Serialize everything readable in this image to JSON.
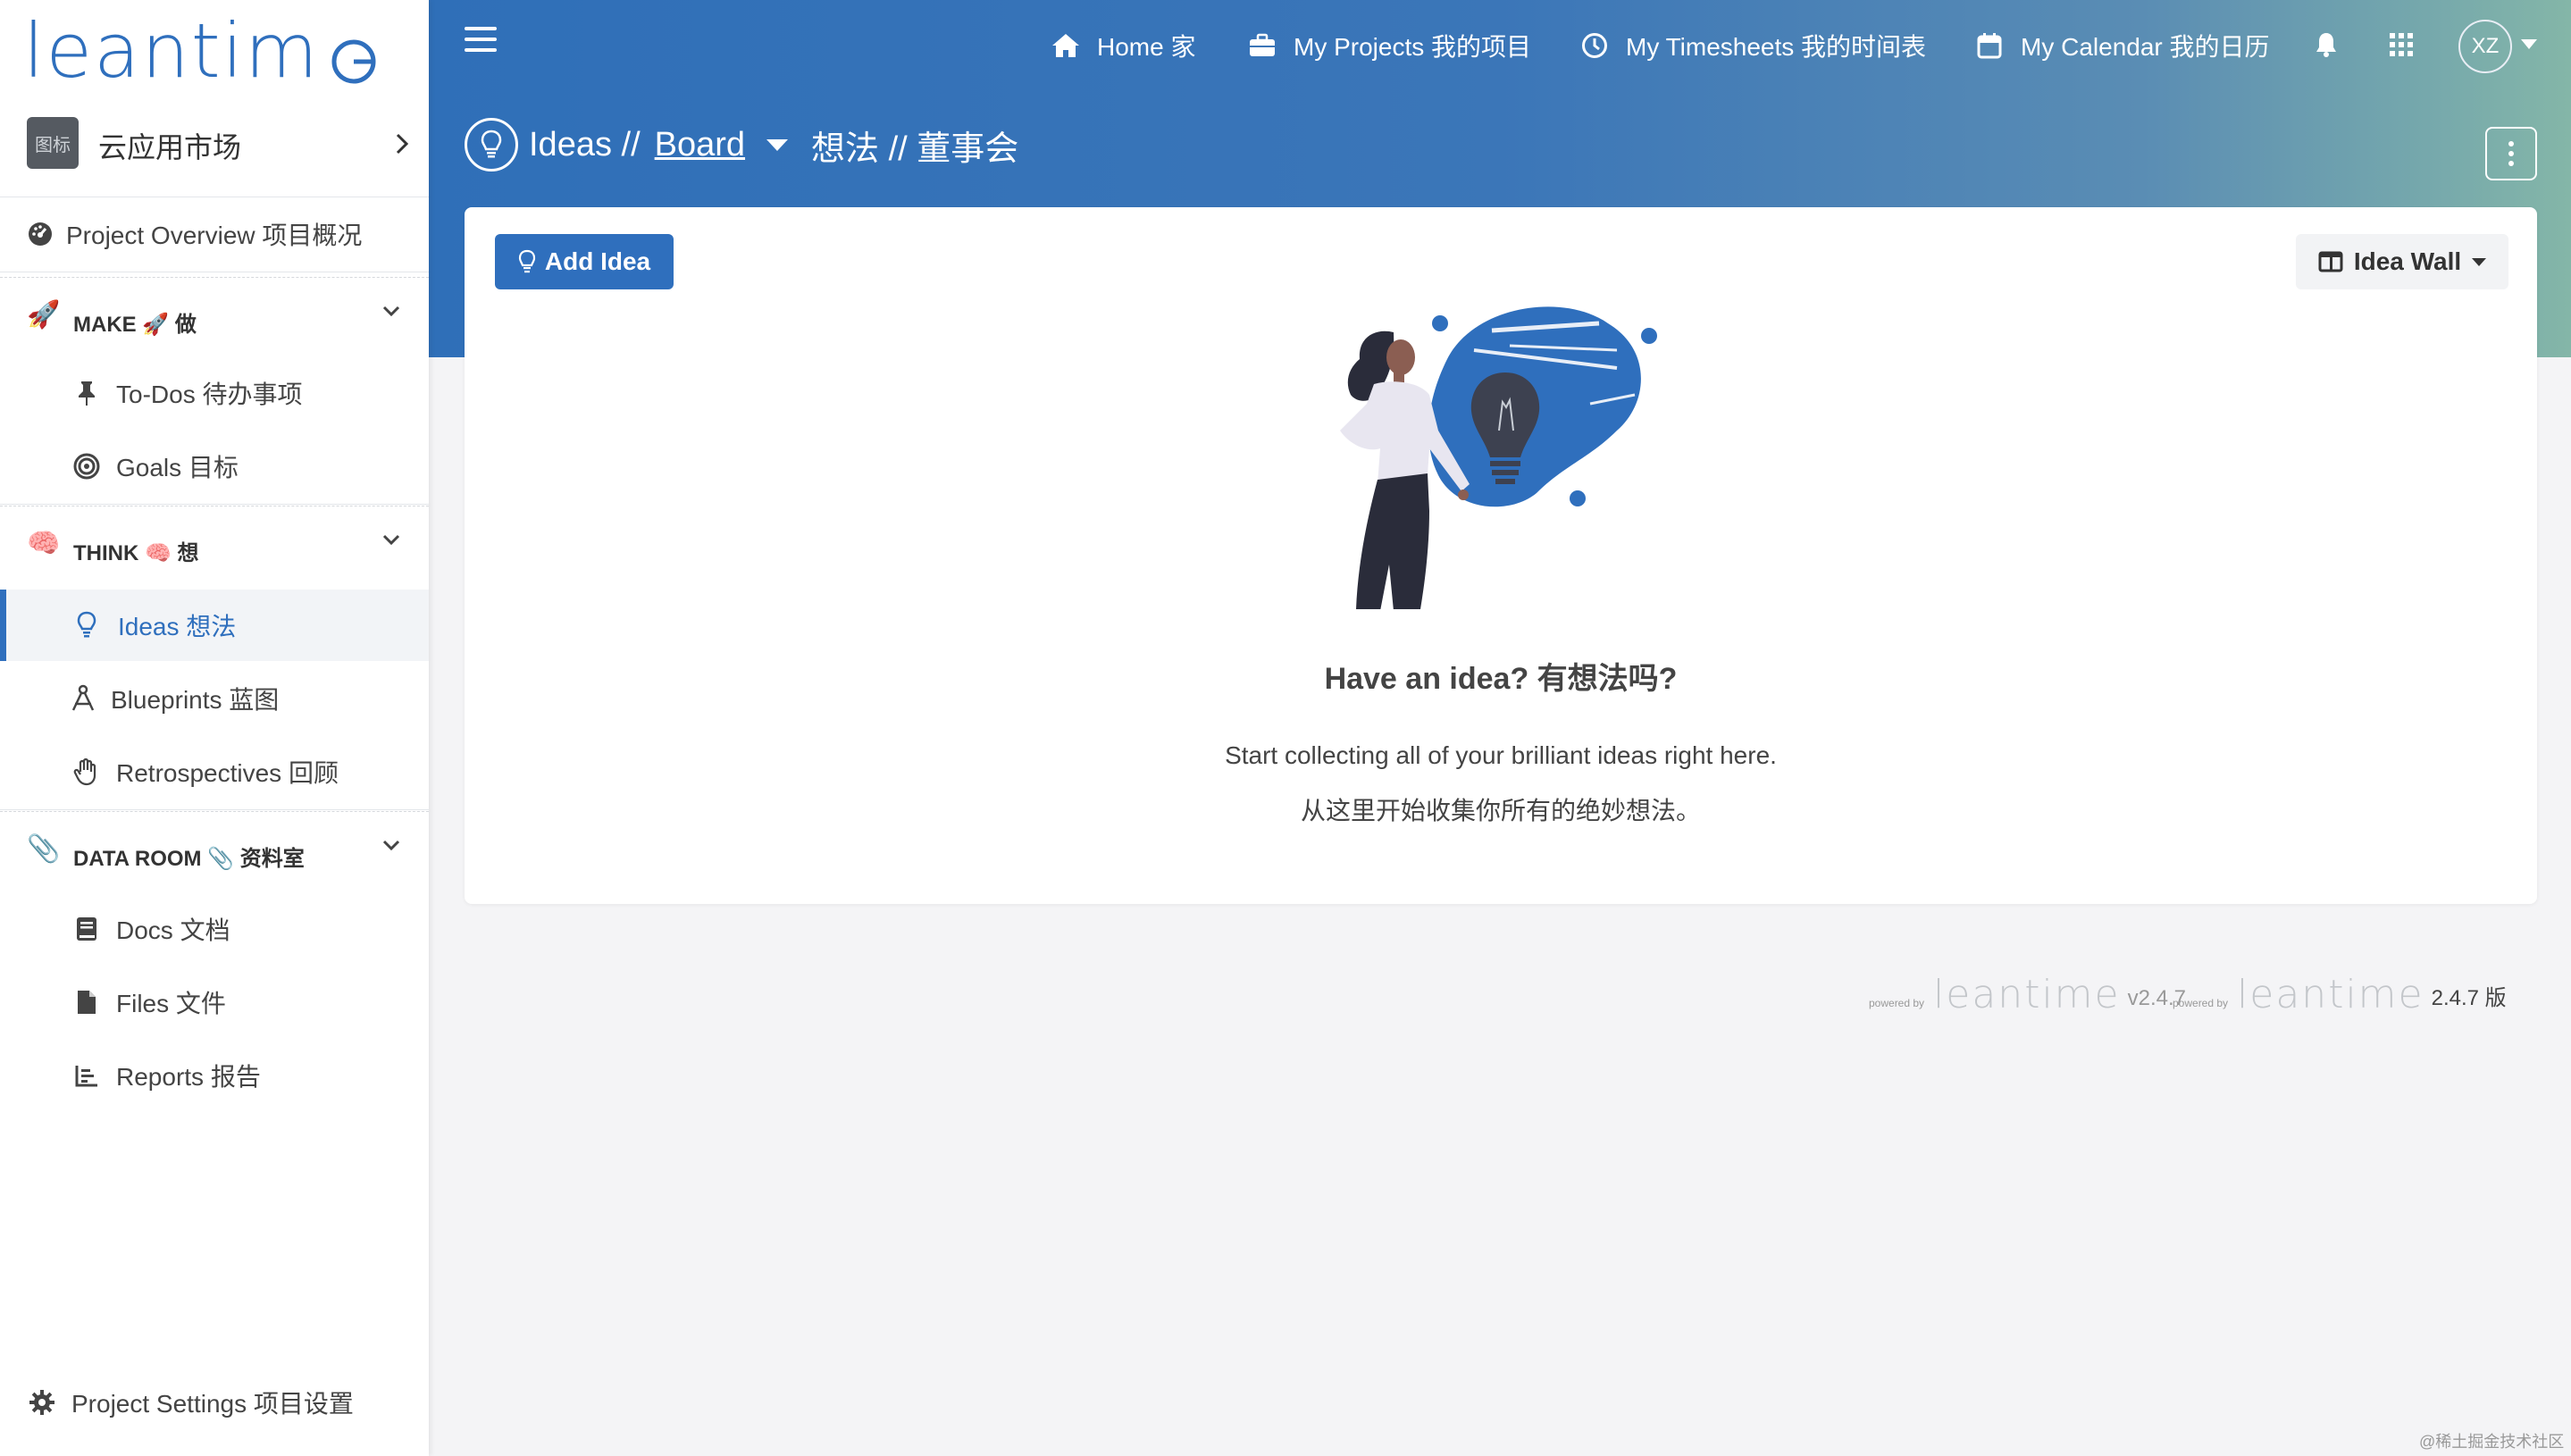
{
  "app": {
    "logo_text": "leantime"
  },
  "project": {
    "avatar_text": "图标",
    "name": "云应用市场"
  },
  "sidebar": {
    "overview": "Project Overview  项目概况",
    "sections": [
      {
        "emoji": "🚀",
        "title": "MAKE 🚀 做",
        "items": [
          {
            "label": "To-Dos  待办事项",
            "icon": "pin-icon"
          },
          {
            "label": "Goals  目标",
            "icon": "target-icon"
          }
        ]
      },
      {
        "emoji": "🧠",
        "title": "THINK 🧠 想",
        "items": [
          {
            "label": "Ideas  想法",
            "icon": "lightbulb-icon",
            "active": true
          },
          {
            "label": "Blueprints  蓝图",
            "icon": "compass-drafting-icon"
          },
          {
            "label": "Retrospectives  回顾",
            "icon": "hand-icon"
          }
        ]
      },
      {
        "emoji": "📎",
        "title": "DATA ROOM 📎 资料室",
        "items": [
          {
            "label": "Docs  文档",
            "icon": "book-icon"
          },
          {
            "label": "Files  文件",
            "icon": "file-icon"
          },
          {
            "label": "Reports  报告",
            "icon": "chart-icon"
          }
        ]
      }
    ],
    "settings": "Project Settings  项目设置"
  },
  "topnav": {
    "home": "Home 家",
    "projects": "My Projects 我的项目",
    "timesheets": "My Timesheets 我的时间表",
    "calendar": "My Calendar 我的日历",
    "user_initials": "XZ"
  },
  "page": {
    "title_prefix": "Ideas //",
    "title_link": "Board",
    "title_suffix": "想法 // 董事会"
  },
  "toolbar": {
    "add_label": "Add Idea",
    "view_label": "Idea Wall"
  },
  "empty_state": {
    "title": "Have an idea? 有想法吗?",
    "line1": "Start collecting all of your brilliant ideas right here.",
    "line2": "从这里开始收集你所有的绝妙想法。"
  },
  "footer": {
    "powered_by": "powered by",
    "brand": "leantime",
    "version1": "v2.4.7",
    "version2": "2.4.7 版"
  },
  "watermark": "@稀土掘金技术社区",
  "colors": {
    "primary": "#2f6fbd",
    "header_start": "#2f6fb8",
    "header_end": "#84b6a8"
  }
}
